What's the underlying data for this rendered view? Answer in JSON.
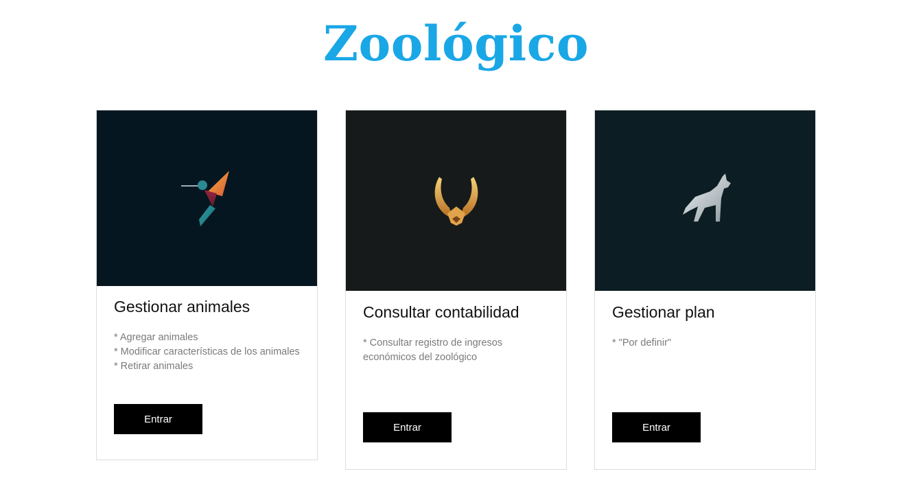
{
  "header": {
    "title": "Zoológico"
  },
  "cards": [
    {
      "icon": "hummingbird-icon",
      "image_bg": "#061620",
      "title": "Gestionar animales",
      "description": [
        "* Agregar animales",
        "* Modificar características de los animales",
        "* Retirar animales"
      ],
      "button_label": "Entrar"
    },
    {
      "icon": "golden-bird-icon",
      "image_bg": "#161a1b",
      "title": "Consultar contabilidad",
      "description": [
        "* Consultar registro de ingresos económicos del zoológico"
      ],
      "button_label": "Entrar"
    },
    {
      "icon": "wolf-icon",
      "image_bg": "#0c1e23",
      "title": "Gestionar plan",
      "description": [
        "* \"Por definir\""
      ],
      "button_label": "Entrar"
    }
  ],
  "colors": {
    "title": "#1aa7e6",
    "button_bg": "#000000",
    "button_text": "#ffffff"
  }
}
